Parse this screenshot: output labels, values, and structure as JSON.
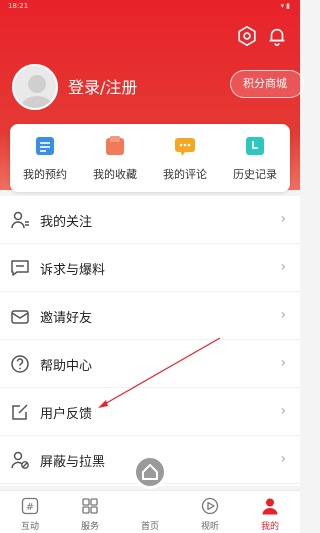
{
  "status": {
    "time": "18:21",
    "icons": "▾▮"
  },
  "header": {
    "login_label": "登录/注册",
    "points_label": "积分商城"
  },
  "quick_actions": [
    {
      "label": "我的预约",
      "icon": "calendar-icon",
      "color": "#3a8ee6"
    },
    {
      "label": "我的收藏",
      "icon": "folder-icon",
      "color": "#f07a5a"
    },
    {
      "label": "我的评论",
      "icon": "comment-icon",
      "color": "#f5a623"
    },
    {
      "label": "历史记录",
      "icon": "history-icon",
      "color": "#2ec7c0"
    }
  ],
  "menu": [
    {
      "label": "我的关注",
      "icon": "follow-icon"
    },
    {
      "label": "诉求与爆料",
      "icon": "report-icon"
    },
    {
      "label": "邀请好友",
      "icon": "invite-icon"
    },
    {
      "label": "帮助中心",
      "icon": "help-icon"
    },
    {
      "label": "用户反馈",
      "icon": "feedback-icon"
    },
    {
      "label": "屏蔽与拉黑",
      "icon": "block-icon"
    }
  ],
  "tabs": [
    {
      "label": "互动",
      "icon": "hash-icon"
    },
    {
      "label": "服务",
      "icon": "grid-icon"
    },
    {
      "label": "首页",
      "icon": "home-icon"
    },
    {
      "label": "视听",
      "icon": "play-icon"
    },
    {
      "label": "我的",
      "icon": "user-icon",
      "active": true
    }
  ],
  "colors": {
    "brand": "#e8222a",
    "menu_icon": "#555555"
  }
}
